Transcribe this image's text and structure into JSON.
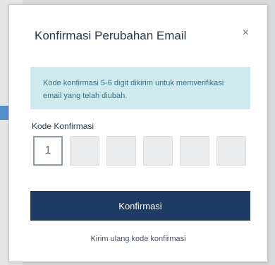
{
  "dialog": {
    "title": "Konfirmasi Perubahan Email",
    "close_label": "×",
    "info_text": "Kode konfirmasi 5-6 digit dikirim untuk memverifikasi email yang telah diubah.",
    "code_label": "Kode Konfirmasi",
    "code_digits": [
      "1",
      "",
      "",
      "",
      "",
      ""
    ],
    "confirm_label": "Konfirmasi",
    "resend_label": "Kirim ulang kode konfirmasi"
  },
  "colors": {
    "primary_button": "#1f3a63",
    "info_background": "#cfeaef",
    "arrow": "#3e86c8"
  },
  "icons": {
    "pointer": "arrow-right-icon",
    "close": "close-icon"
  }
}
